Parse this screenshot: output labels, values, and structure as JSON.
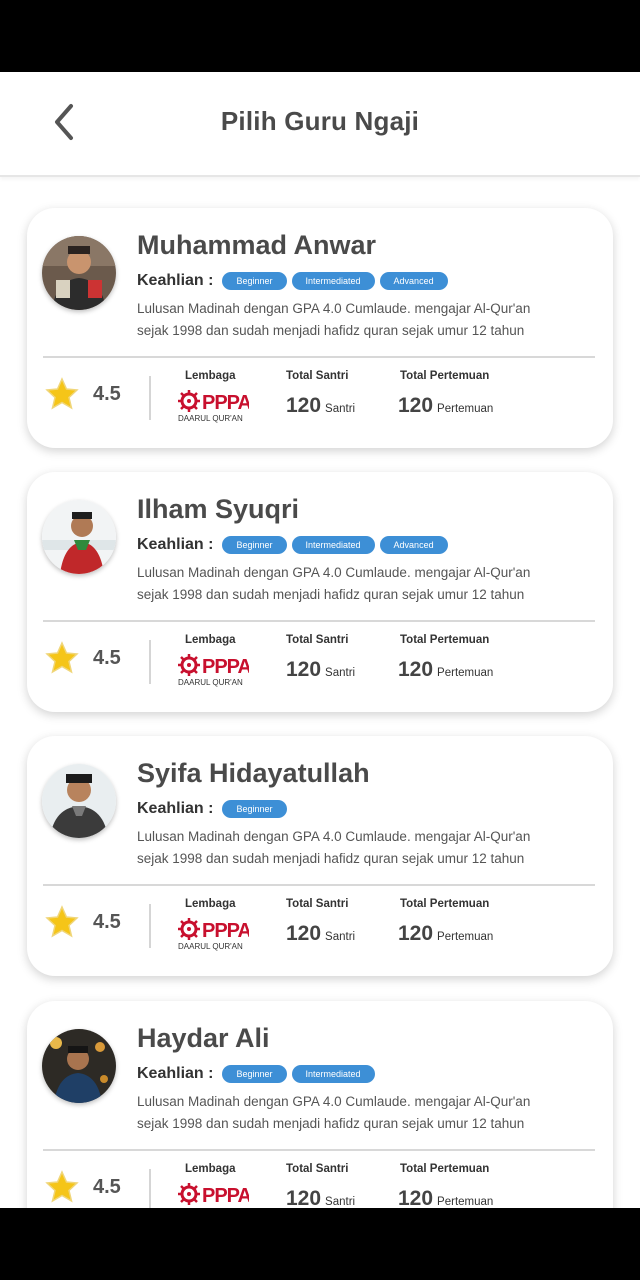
{
  "header": {
    "title": "Pilih Guru Ngaji"
  },
  "labels": {
    "skills": "Keahlian :",
    "institution": "Lembaga",
    "total_students": "Total Santri",
    "total_meetings": "Total Pertemuan",
    "students_unit": "Santri",
    "meetings_unit": "Pertemuan",
    "logo_top": "PPPA",
    "logo_bottom": "DAARUL QUR'AN"
  },
  "teachers": [
    {
      "name": "Muhammad Anwar",
      "skills": [
        "Beginner",
        "Intermediated",
        "Advanced"
      ],
      "description": "Lulusan Madinah dengan GPA 4.0 Cumlaude. mengajar Al-Qur'an sejak 1998 dan sudah menjadi hafidz quran sejak umur 12 tahun",
      "rating": "4.5",
      "total_students": "120",
      "total_meetings": "120"
    },
    {
      "name": "Ilham Syuqri",
      "skills": [
        "Beginner",
        "Intermediated",
        "Advanced"
      ],
      "description": "Lulusan Madinah dengan GPA 4.0 Cumlaude. mengajar Al-Qur'an sejak 1998 dan sudah menjadi hafidz quran sejak umur 12 tahun",
      "rating": "4.5",
      "total_students": "120",
      "total_meetings": "120"
    },
    {
      "name": "Syifa Hidayatullah",
      "skills": [
        "Beginner"
      ],
      "description": "Lulusan Madinah dengan GPA 4.0 Cumlaude. mengajar Al-Qur'an sejak 1998 dan sudah menjadi hafidz quran sejak umur 12 tahun",
      "rating": "4.5",
      "total_students": "120",
      "total_meetings": "120"
    },
    {
      "name": "Haydar Ali",
      "skills": [
        "Beginner",
        "Intermediated"
      ],
      "description": "Lulusan Madinah dengan GPA 4.0 Cumlaude. mengajar Al-Qur'an sejak 1998 dan sudah menjadi hafidz quran sejak umur 12 tahun",
      "rating": "4.5",
      "total_students": "120",
      "total_meetings": "120"
    }
  ],
  "colors": {
    "badge": "#3d8fd6",
    "star": "#f5c518",
    "logo": "#c8102e"
  }
}
